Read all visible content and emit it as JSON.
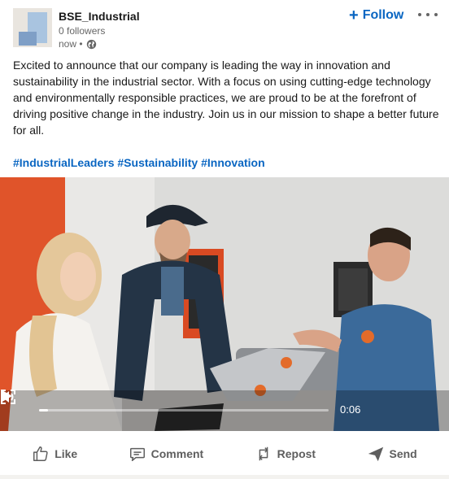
{
  "author": {
    "name": "BSE_Industrial",
    "followers": "0 followers",
    "time": "now •",
    "avatar_icon": "company-logo-icon",
    "visibility_icon": "globe-icon"
  },
  "header_actions": {
    "follow_plus": "+",
    "follow_label": "Follow",
    "more_icon": "more-options-icon"
  },
  "post": {
    "text": "Excited to announce that our company is leading the way in innovation and sustainability in the industrial sector. With a focus on using cutting-edge technology and environmentally responsible practices, we are proud to be at the forefront of driving positive change in the industry. Join us in our mission to shape a better future for all.",
    "hashtags": [
      "#IndustrialLeaders",
      "#Sustainability",
      "#Innovation"
    ]
  },
  "video": {
    "time": "0:06",
    "progress": 0.03,
    "play_icon": "play-icon",
    "volume_icon": "volume-icon",
    "fullscreen_icon": "fullscreen-icon"
  },
  "actions": [
    {
      "label": "Like",
      "icon": "thumbs-up-icon"
    },
    {
      "label": "Comment",
      "icon": "comment-icon"
    },
    {
      "label": "Repost",
      "icon": "repost-icon"
    },
    {
      "label": "Send",
      "icon": "send-icon"
    }
  ],
  "colors": {
    "accent": "#0a66c2",
    "text": "#191919",
    "muted": "#666666",
    "wall_orange": "#e0542a"
  }
}
